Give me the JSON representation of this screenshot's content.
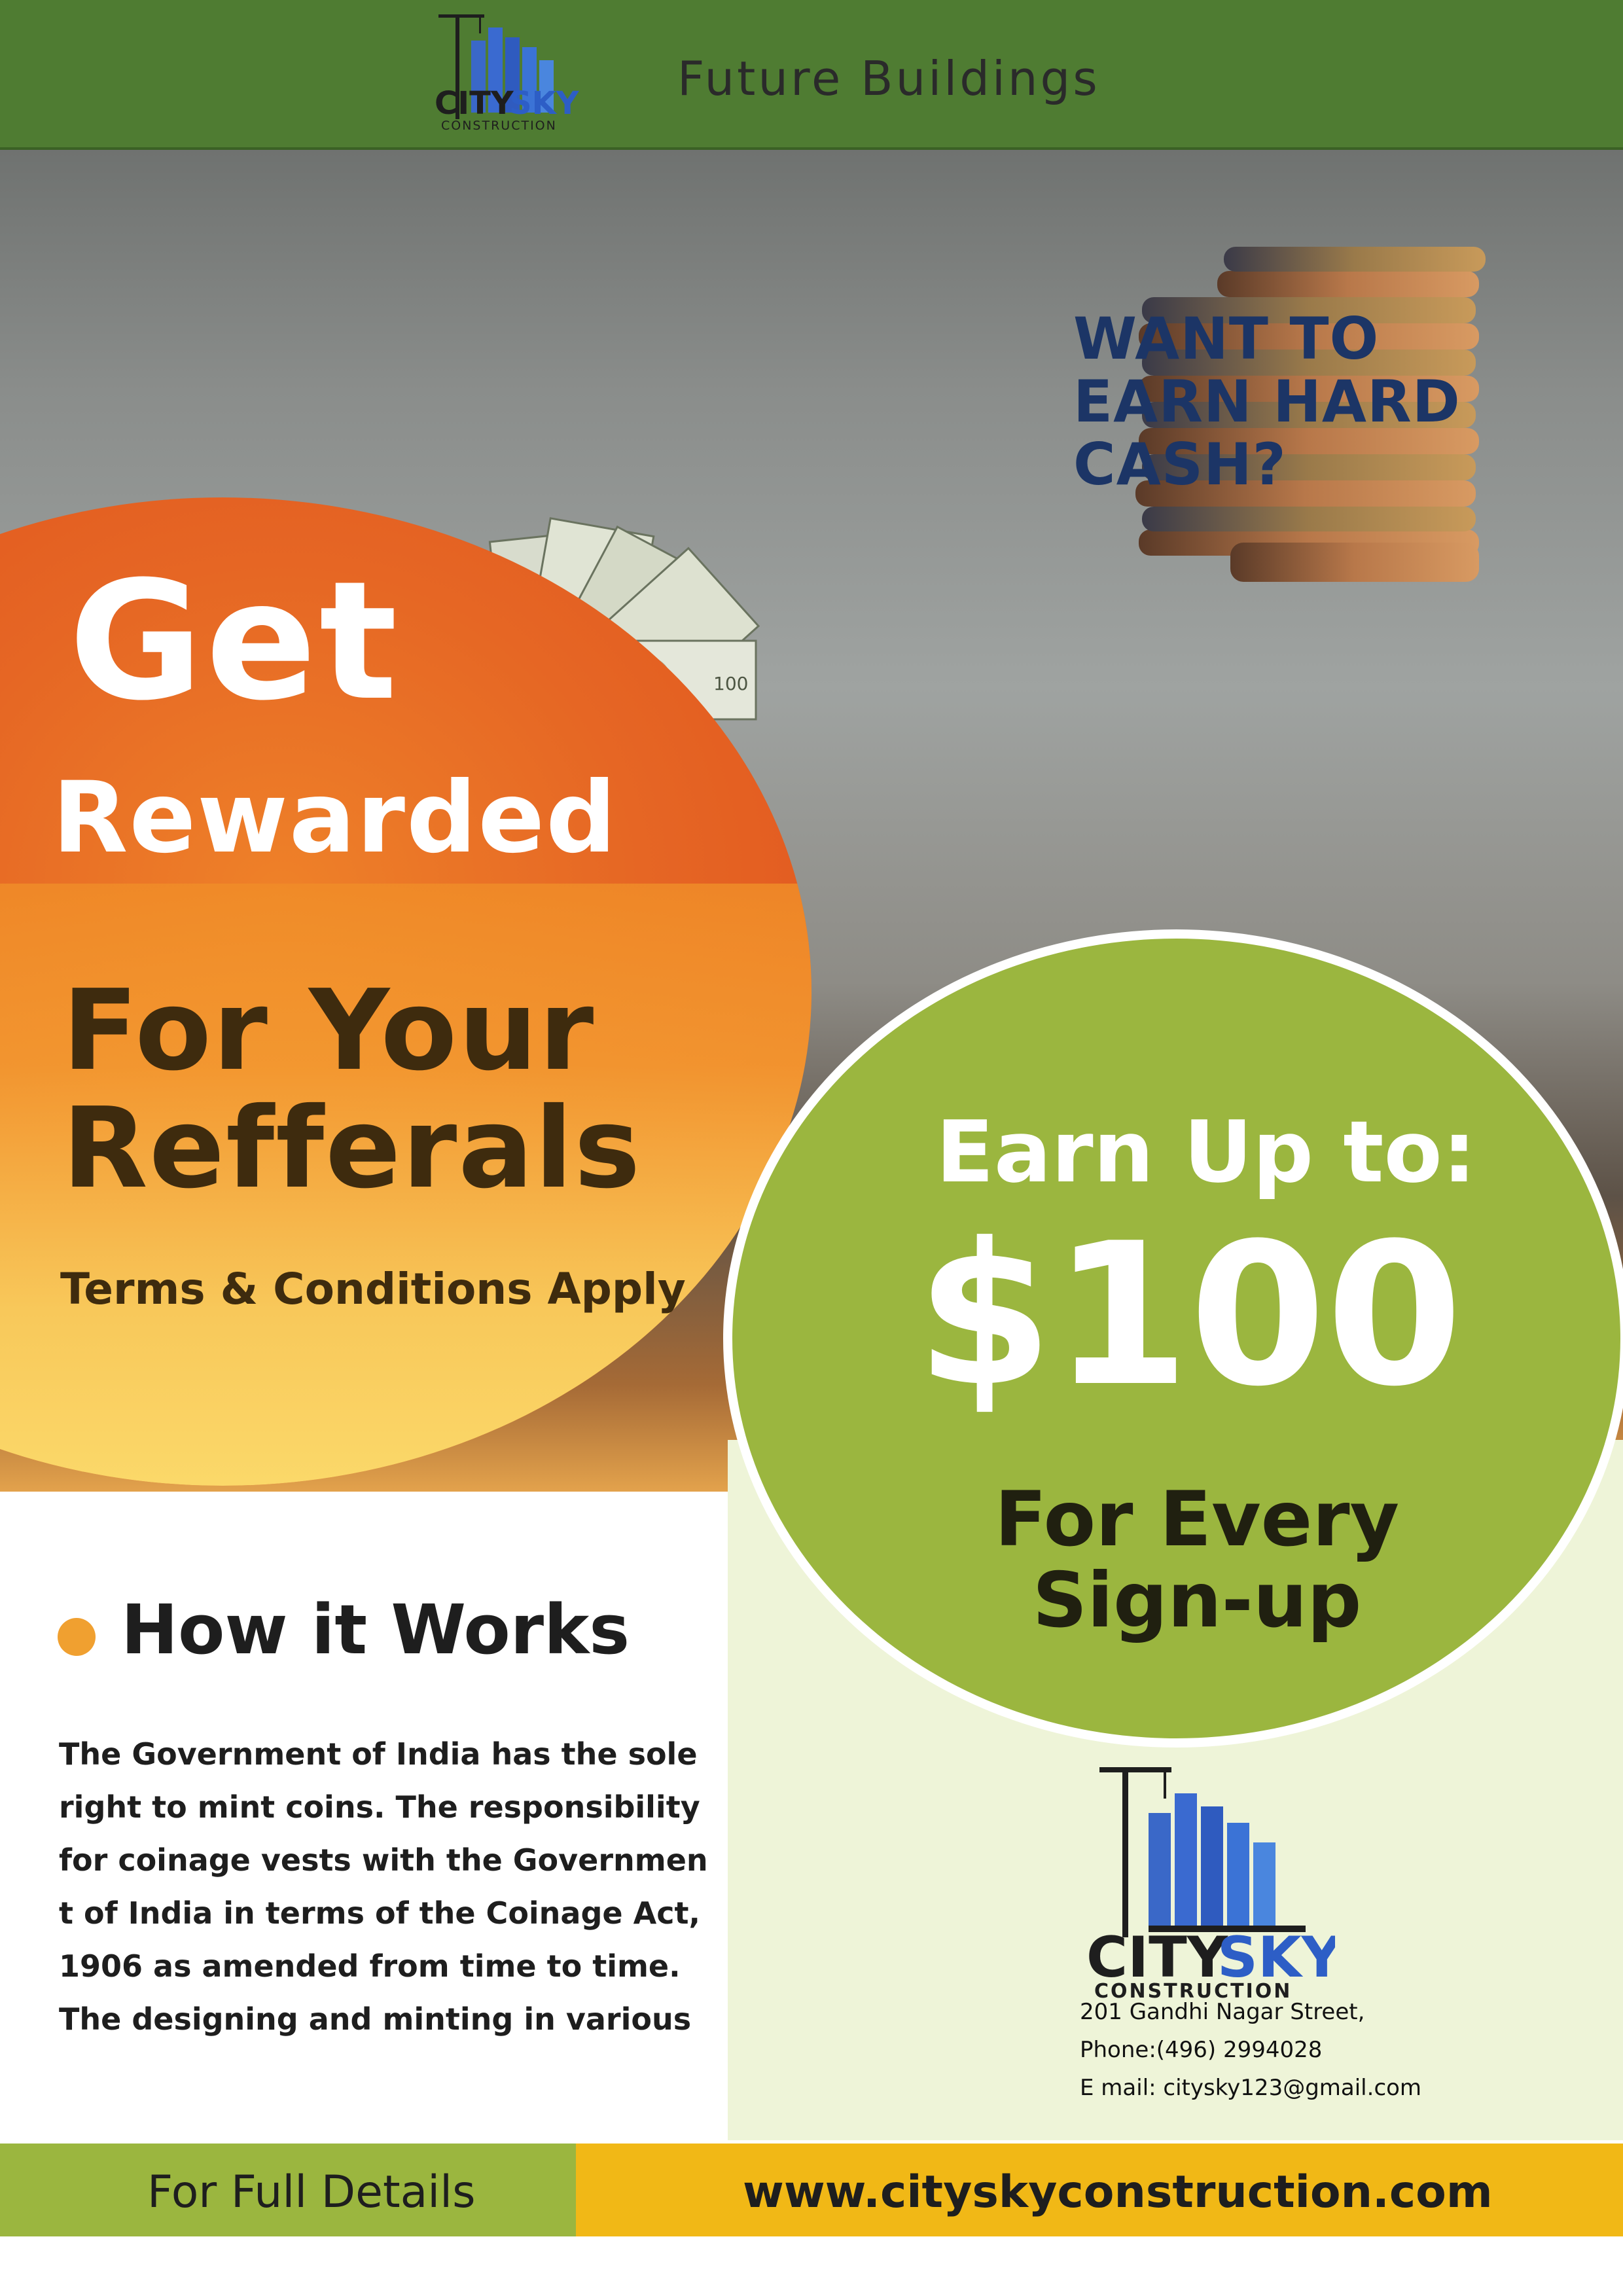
{
  "header": {
    "brand": {
      "city": "CITY",
      "sky": "SKY",
      "sub": "CONSTRUCTION",
      "tagline": "FUTURE BUILDINGS"
    },
    "title": "Future Buildings"
  },
  "hero": {
    "question": [
      "WANT TO",
      "EARN HARD",
      "CASH?"
    ],
    "get": "Get",
    "rewarded": "Rewarded",
    "for_your": "For Your",
    "refferals": "Refferals",
    "terms": "Terms & Conditions Apply"
  },
  "offer": {
    "earn_up_to": "Earn Up to:",
    "amount": "$100",
    "for_every": [
      "For Every",
      "Sign-up"
    ]
  },
  "how_it_works": {
    "title": "How it Works",
    "lines": [
      "The Government of India has the sole",
      "right to mint coins. The responsibility",
      "for coinage vests with the Governmen",
      "t of India in terms of the Coinage Act,",
      "1906 as amended from time to time.",
      "The designing and minting in various"
    ]
  },
  "contact": {
    "brand": {
      "city": "CITY",
      "sky": "SKY",
      "sub": "CONSTRUCTION",
      "tagline": "FUTURE BUILDINGS"
    },
    "address": "201 Gandhi Nagar Street,",
    "phone": "Phone:(496) 2994028",
    "email": "E mail: citysky123@gmail.com"
  },
  "footer": {
    "details_label": "For Full Details",
    "website": "www.cityskyconstruction.com"
  },
  "colors": {
    "header_green": "#4f7c32",
    "offer_green": "#9bb63f",
    "orange": "#e07a30",
    "yellow": "#f1b816",
    "navy": "#1c3566"
  }
}
